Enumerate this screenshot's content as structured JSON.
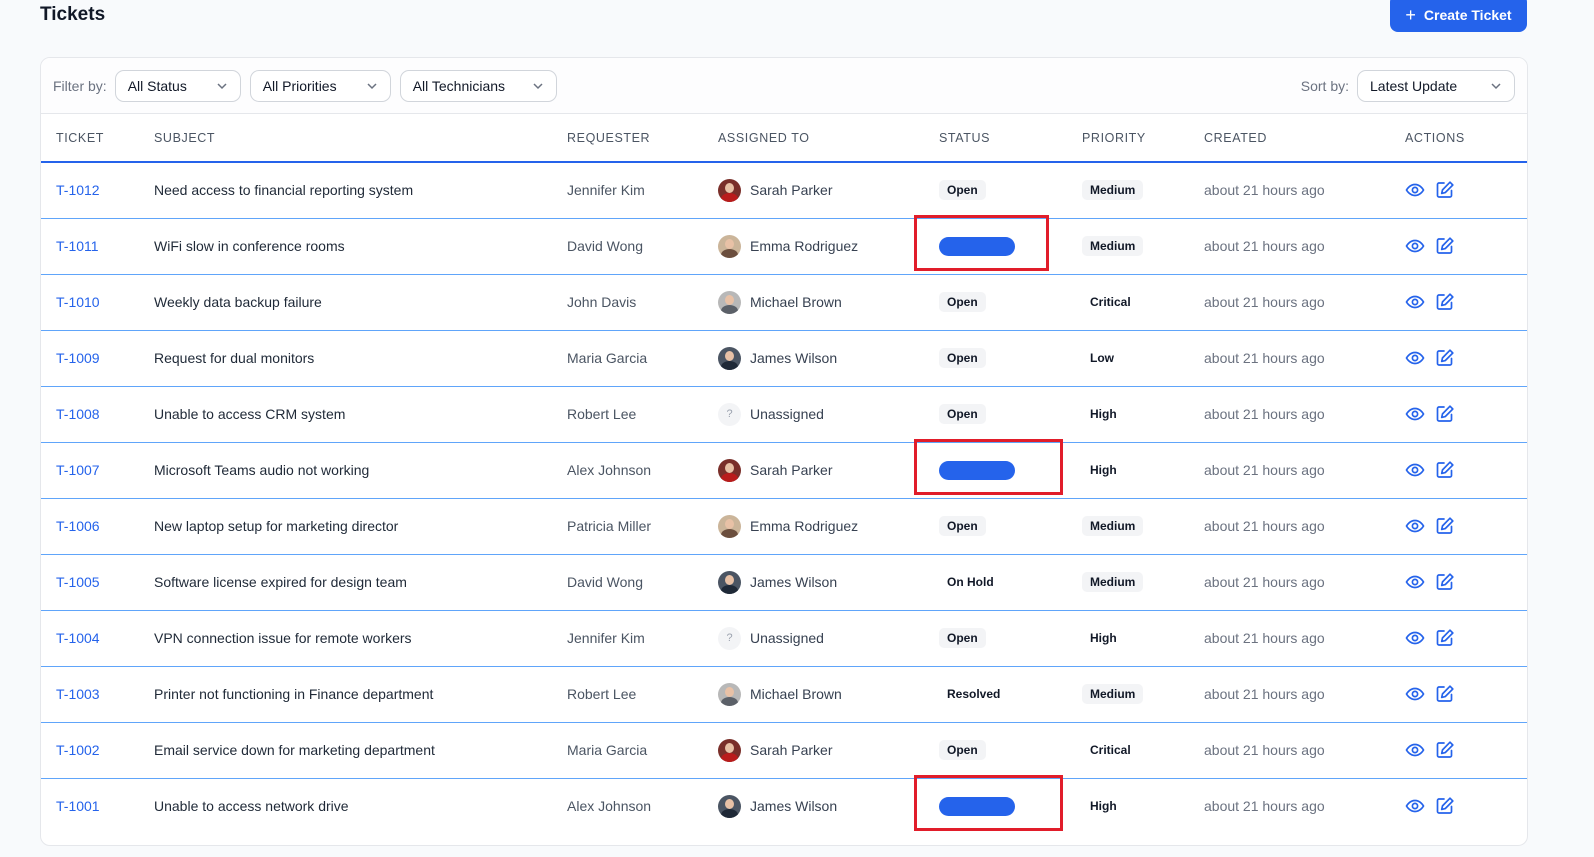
{
  "header": {
    "title": "Tickets",
    "create_label": "Create Ticket",
    "create_icon": "plus-icon"
  },
  "filters": {
    "label": "Filter by:",
    "status": "All Status",
    "priorities": "All Priorities",
    "technicians": "All Technicians",
    "sort_label": "Sort by:",
    "sort": "Latest Update"
  },
  "columns": {
    "ticket": "TICKET",
    "subject": "SUBJECT",
    "requester": "REQUESTER",
    "assigned": "ASSIGNED TO",
    "status": "STATUS",
    "priority": "PRIORITY",
    "created": "CREATED",
    "actions": "ACTIONS"
  },
  "colors": {
    "accent": "#2563eb",
    "highlight": "#e11d2a"
  },
  "rows": [
    {
      "id": "T-1012",
      "subject": "Need access to financial reporting system",
      "requester": "Jennifer Kim",
      "assignee": "Sarah Parker",
      "avatar": "sarah",
      "status": "Open",
      "priority": "Medium",
      "created": "about 21 hours ago"
    },
    {
      "id": "T-1011",
      "subject": "WiFi slow in conference rooms",
      "requester": "David Wong",
      "assignee": "Emma Rodriguez",
      "avatar": "emma",
      "status": "",
      "priority": "Medium",
      "created": "about 21 hours ago"
    },
    {
      "id": "T-1010",
      "subject": "Weekly data backup failure",
      "requester": "John Davis",
      "assignee": "Michael Brown",
      "avatar": "michael",
      "status": "Open",
      "priority": "Critical",
      "created": "about 21 hours ago"
    },
    {
      "id": "T-1009",
      "subject": "Request for dual monitors",
      "requester": "Maria Garcia",
      "assignee": "James Wilson",
      "avatar": "james",
      "status": "Open",
      "priority": "Low",
      "created": "about 21 hours ago"
    },
    {
      "id": "T-1008",
      "subject": "Unable to access CRM system",
      "requester": "Robert Lee",
      "assignee": "Unassigned",
      "avatar": "unassigned",
      "status": "Open",
      "priority": "High",
      "created": "about 21 hours ago"
    },
    {
      "id": "T-1007",
      "subject": "Microsoft Teams audio not working",
      "requester": "Alex Johnson",
      "assignee": "Sarah Parker",
      "avatar": "sarah",
      "status": "",
      "priority": "High",
      "created": "about 21 hours ago"
    },
    {
      "id": "T-1006",
      "subject": "New laptop setup for marketing director",
      "requester": "Patricia Miller",
      "assignee": "Emma Rodriguez",
      "avatar": "emma",
      "status": "Open",
      "priority": "Medium",
      "created": "about 21 hours ago"
    },
    {
      "id": "T-1005",
      "subject": "Software license expired for design team",
      "requester": "David Wong",
      "assignee": "James Wilson",
      "avatar": "james",
      "status": "On Hold",
      "priority": "Medium",
      "created": "about 21 hours ago"
    },
    {
      "id": "T-1004",
      "subject": "VPN connection issue for remote workers",
      "requester": "Jennifer Kim",
      "assignee": "Unassigned",
      "avatar": "unassigned",
      "status": "Open",
      "priority": "High",
      "created": "about 21 hours ago"
    },
    {
      "id": "T-1003",
      "subject": "Printer not functioning in Finance department",
      "requester": "Robert Lee",
      "assignee": "Michael Brown",
      "avatar": "michael",
      "status": "Resolved",
      "priority": "Medium",
      "created": "about 21 hours ago"
    },
    {
      "id": "T-1002",
      "subject": "Email service down for marketing department",
      "requester": "Maria Garcia",
      "assignee": "Sarah Parker",
      "avatar": "sarah",
      "status": "Open",
      "priority": "Critical",
      "created": "about 21 hours ago"
    },
    {
      "id": "T-1001",
      "subject": "Unable to access network drive",
      "requester": "Alex Johnson",
      "assignee": "James Wilson",
      "avatar": "james",
      "status": "",
      "priority": "High",
      "created": "about 21 hours ago"
    }
  ]
}
